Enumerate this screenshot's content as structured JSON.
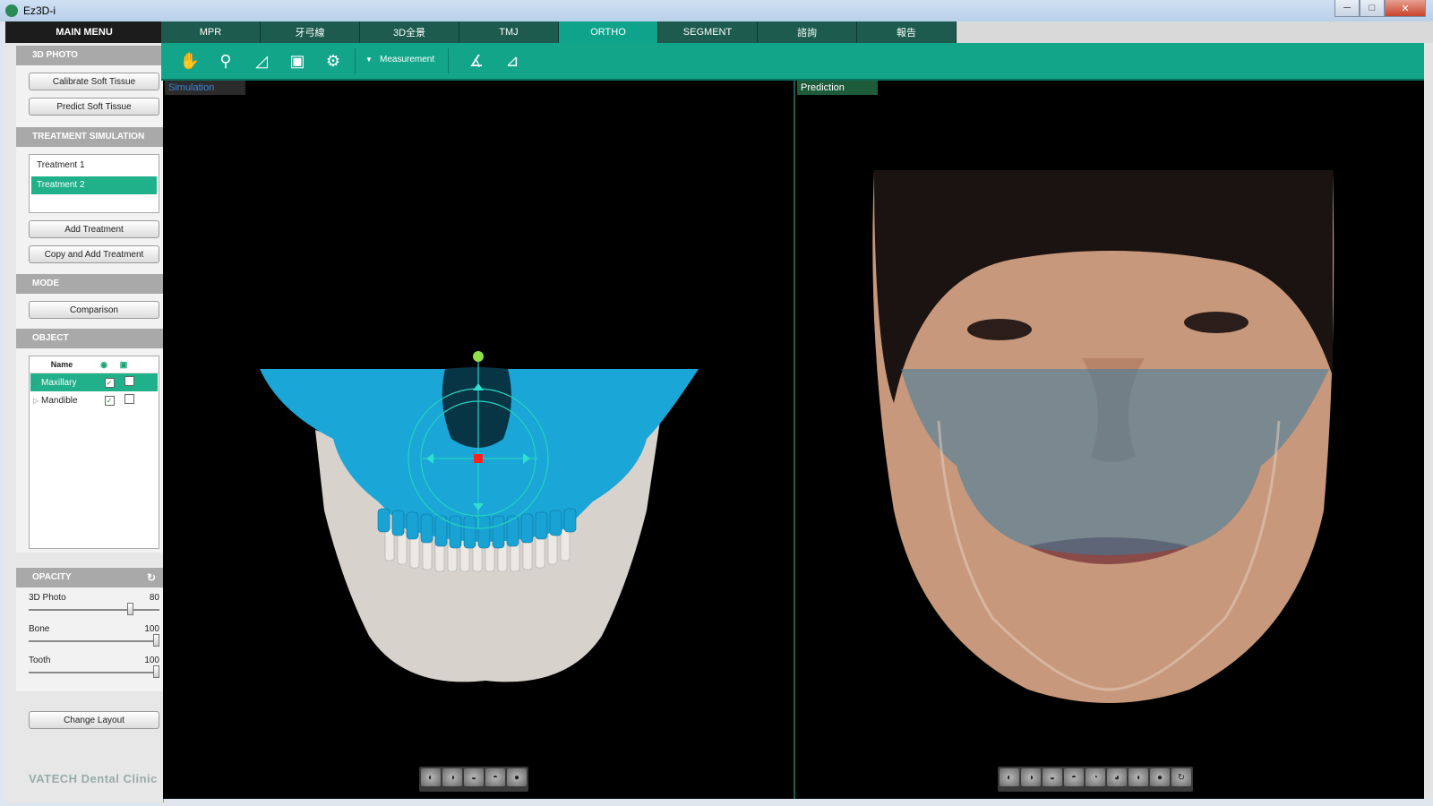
{
  "window": {
    "title": "Ez3D-i",
    "minimize_label": "─",
    "maximize_label": "□",
    "close_label": "✕"
  },
  "main_menu_label": "MAIN MENU",
  "sections": {
    "photo3d": {
      "title": "3D PHOTO",
      "buttons": [
        "Calibrate Soft Tissue",
        "Predict Soft Tissue"
      ]
    },
    "treatment": {
      "title": "TREATMENT SIMULATION",
      "items": [
        "Treatment 1",
        "Treatment 2"
      ],
      "selected": "Treatment 2",
      "buttons": [
        "Add Treatment",
        "Copy and Add Treatment"
      ]
    },
    "mode": {
      "title": "MODE",
      "button": "Comparison"
    },
    "object": {
      "title": "OBJECT",
      "col_name": "Name",
      "rows": [
        {
          "name": "Maxillary",
          "visible": true,
          "locked": false,
          "selected": true
        },
        {
          "name": "Mandible",
          "visible": true,
          "locked": false,
          "selected": false
        }
      ]
    },
    "opacity": {
      "title": "OPACITY",
      "sliders": [
        {
          "label": "3D Photo",
          "value": 80
        },
        {
          "label": "Bone",
          "value": 100
        },
        {
          "label": "Tooth",
          "value": 100
        }
      ]
    },
    "layout_button": "Change Layout"
  },
  "logo": "VATECH Dental Clinic",
  "tabs": [
    "MPR",
    "牙弓線",
    "3D全景",
    "TMJ",
    "ORTHO",
    "SEGMENT",
    "諮詢",
    "報告"
  ],
  "active_tab": "ORTHO",
  "toolbar": {
    "measurement_label": "Measurement"
  },
  "viewports": {
    "left_label": "Simulation",
    "right_label": "Prediction"
  },
  "colors": {
    "accent": "#13a58a",
    "maxilla": "#1aa6d6",
    "mandible": "#d8d2cc",
    "skin": "#c8987c"
  }
}
